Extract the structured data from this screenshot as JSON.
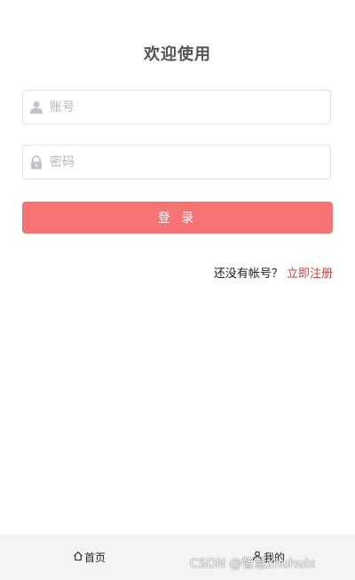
{
  "page": {
    "title": "欢迎使用"
  },
  "form": {
    "username_placeholder": "账号",
    "password_placeholder": "密码",
    "login_label": "登 录",
    "register_prompt": "还没有帐号？",
    "register_link": "立即注册"
  },
  "tabbar": {
    "items": [
      {
        "label": "首页",
        "icon": "home-icon"
      },
      {
        "label": "我的",
        "icon": "user-icon"
      }
    ]
  },
  "watermark": "CSDN @智慧zhuhuix",
  "colors": {
    "accent": "#f56c6c",
    "link": "#e53935",
    "placeholder": "#b7b7b7",
    "tabbar_bg": "#f4f4f4"
  }
}
